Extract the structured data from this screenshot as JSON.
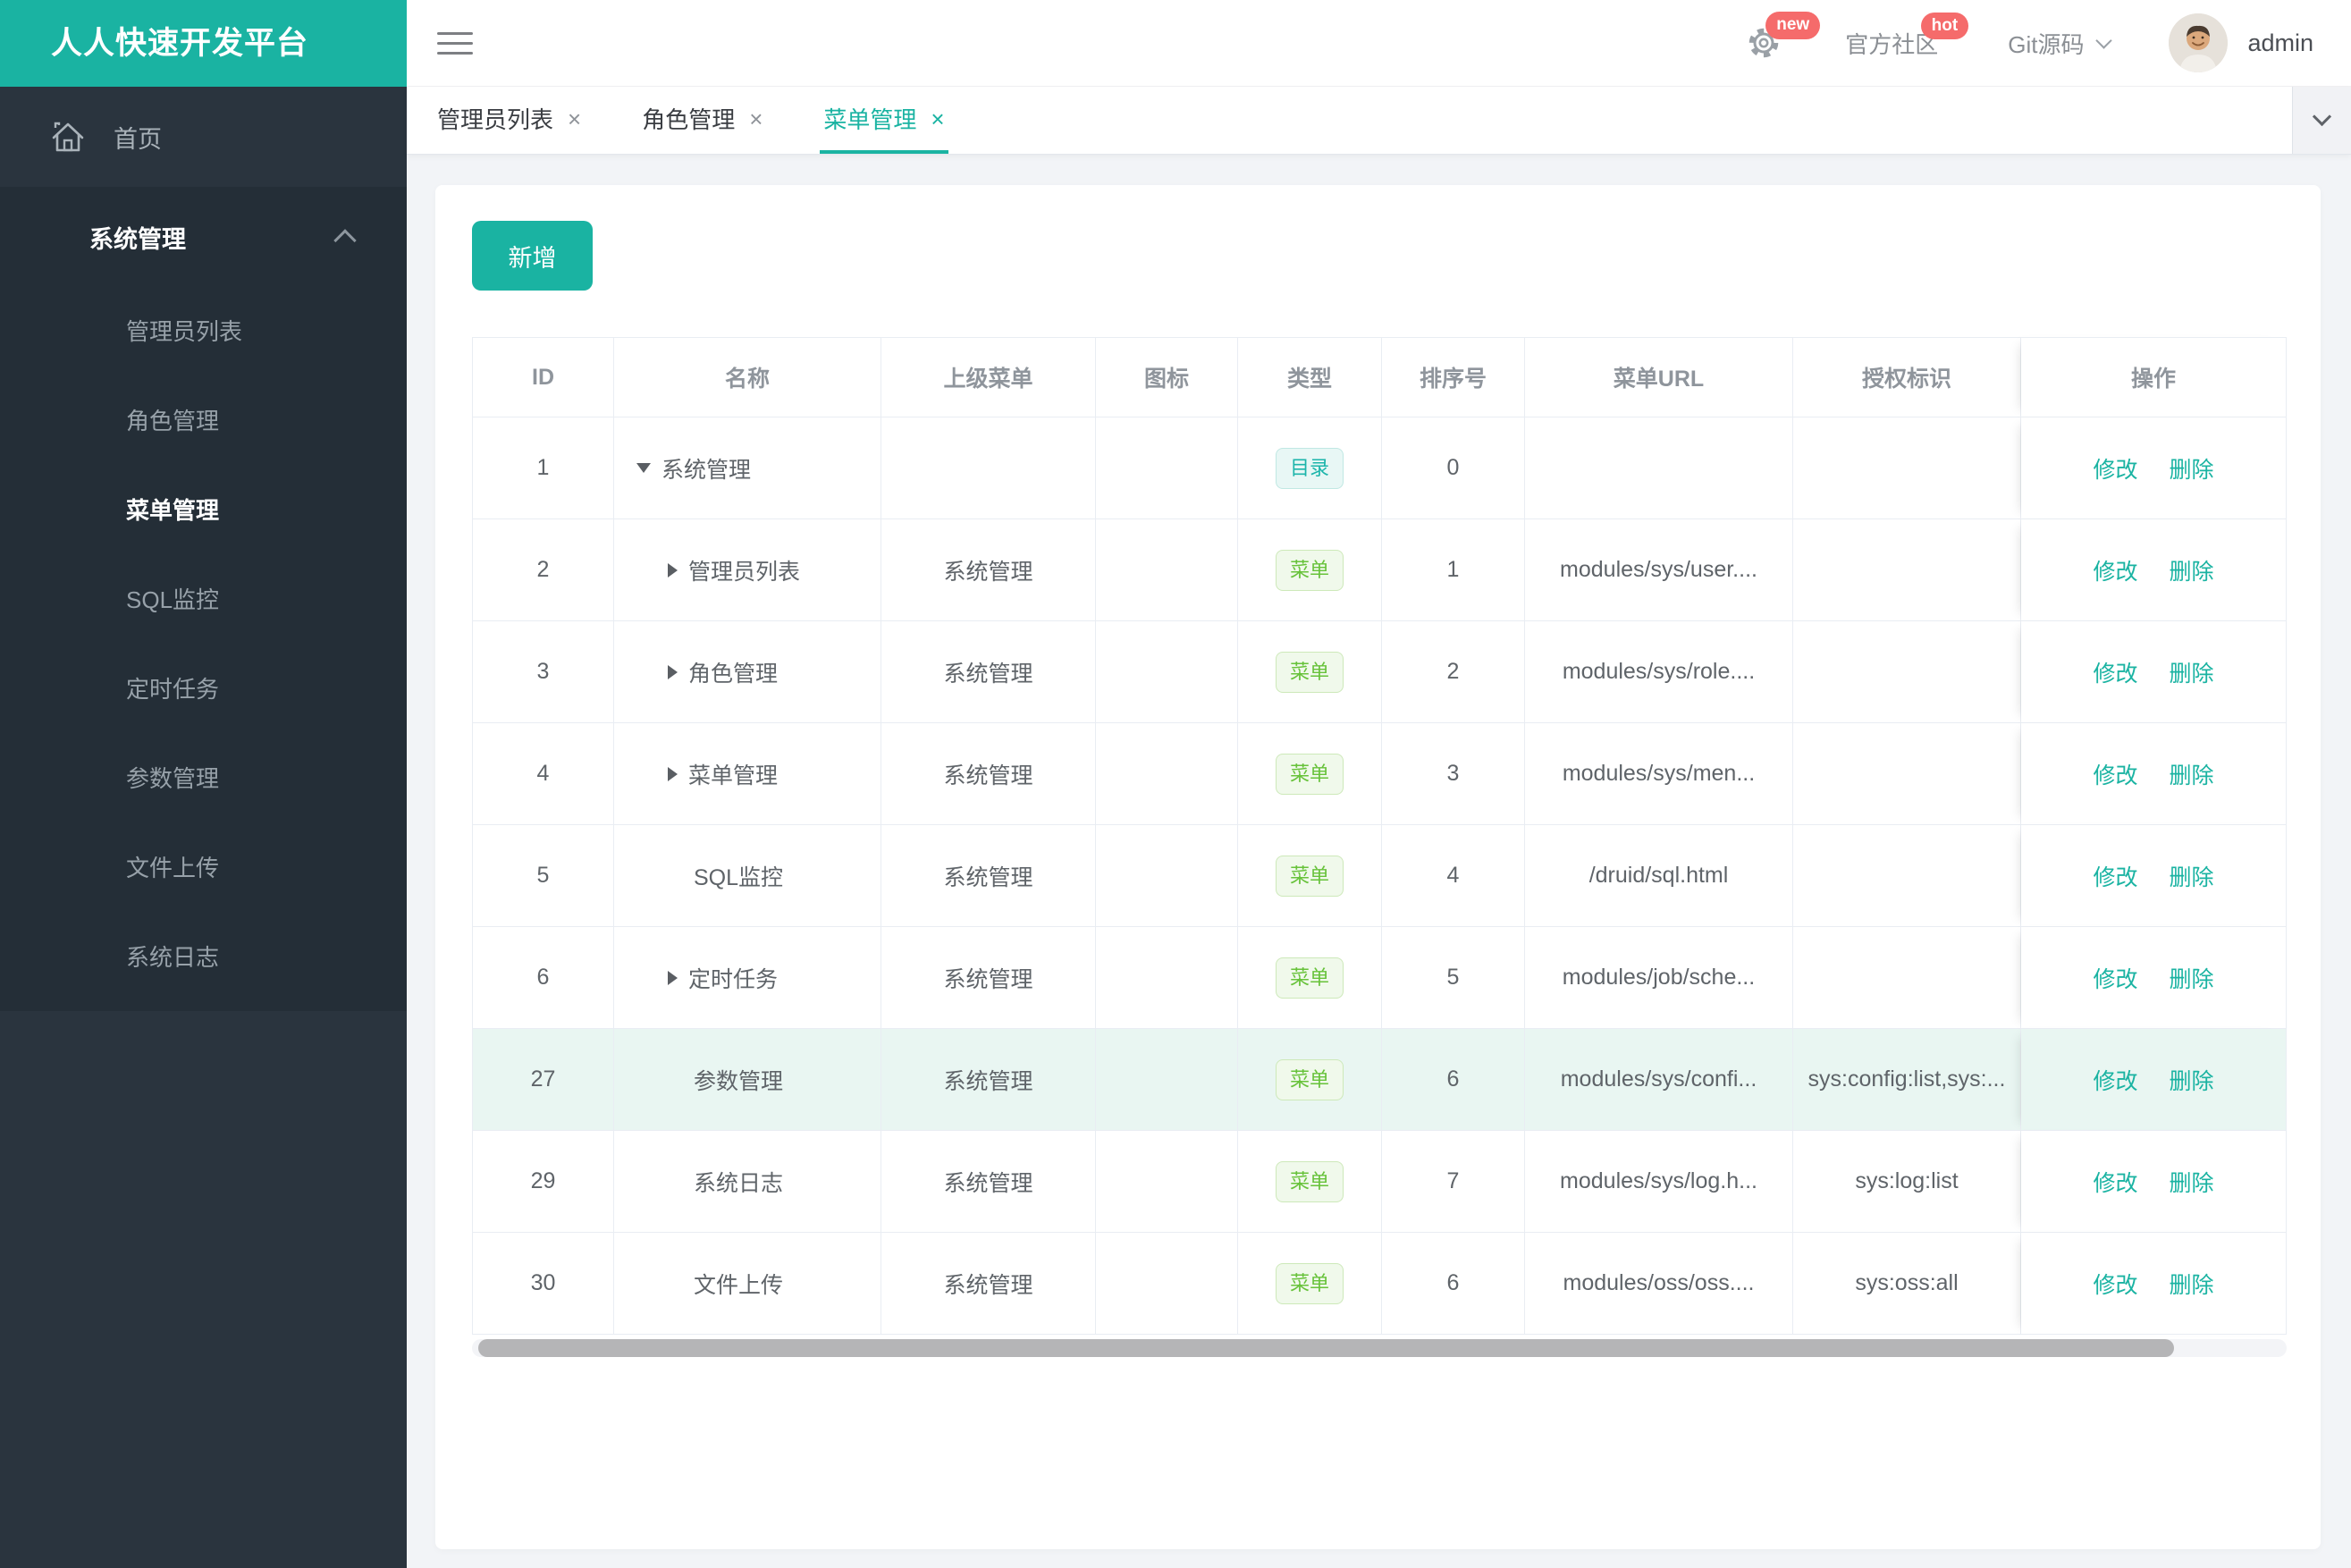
{
  "colors": {
    "primary_teal": "#1ab3a2",
    "badge_red": "#f56b6b",
    "tag_dir_text": "#1db5ab",
    "tag_menu_text": "#67c23a",
    "sidebar_bg": "#2a343e",
    "submenu_bg": "#242e37",
    "highlight_row_bg": "#e9f6f2"
  },
  "icons": {
    "close": "×"
  },
  "logo": {
    "title": "人人快速开发平台"
  },
  "topbar": {
    "new_badge": "new",
    "community": "官方社区",
    "hot_badge": "hot",
    "git": "Git源码",
    "username": "admin"
  },
  "sidebar": {
    "home": "首页",
    "group_title": "系统管理",
    "items": [
      {
        "label": "管理员列表",
        "active": false
      },
      {
        "label": "角色管理",
        "active": false
      },
      {
        "label": "菜单管理",
        "active": true
      },
      {
        "label": "SQL监控",
        "active": false
      },
      {
        "label": "定时任务",
        "active": false
      },
      {
        "label": "参数管理",
        "active": false
      },
      {
        "label": "文件上传",
        "active": false
      },
      {
        "label": "系统日志",
        "active": false
      }
    ]
  },
  "tabs": {
    "items": [
      {
        "label": "管理员列表",
        "active": false
      },
      {
        "label": "角色管理",
        "active": false
      },
      {
        "label": "菜单管理",
        "active": true
      }
    ]
  },
  "toolbar": {
    "add_label": "新增"
  },
  "table": {
    "columns": [
      "ID",
      "名称",
      "上级菜单",
      "图标",
      "类型",
      "排序号",
      "菜单URL",
      "授权标识",
      "操作"
    ],
    "actions": {
      "edit": "修改",
      "delete": "删除"
    },
    "rows": [
      {
        "id": "1",
        "caret": "down",
        "name": "系统管理",
        "parent": "",
        "icon": "",
        "type_label": "目录",
        "order": "0",
        "url": "",
        "perms": "",
        "highlighted": false
      },
      {
        "id": "2",
        "caret": "right",
        "name": "管理员列表",
        "parent": "系统管理",
        "icon": "",
        "type_label": "菜单",
        "order": "1",
        "url": "modules/sys/user....",
        "perms": "",
        "highlighted": false
      },
      {
        "id": "3",
        "caret": "right",
        "name": "角色管理",
        "parent": "系统管理",
        "icon": "",
        "type_label": "菜单",
        "order": "2",
        "url": "modules/sys/role....",
        "perms": "",
        "highlighted": false
      },
      {
        "id": "4",
        "caret": "right",
        "name": "菜单管理",
        "parent": "系统管理",
        "icon": "",
        "type_label": "菜单",
        "order": "3",
        "url": "modules/sys/men...",
        "perms": "",
        "highlighted": false
      },
      {
        "id": "5",
        "caret": "none",
        "name": "SQL监控",
        "parent": "系统管理",
        "icon": "",
        "type_label": "菜单",
        "order": "4",
        "url": "/druid/sql.html",
        "perms": "",
        "highlighted": false
      },
      {
        "id": "6",
        "caret": "right",
        "name": "定时任务",
        "parent": "系统管理",
        "icon": "",
        "type_label": "菜单",
        "order": "5",
        "url": "modules/job/sche...",
        "perms": "",
        "highlighted": false
      },
      {
        "id": "27",
        "caret": "none",
        "name": "参数管理",
        "parent": "系统管理",
        "icon": "",
        "type_label": "菜单",
        "order": "6",
        "url": "modules/sys/confi...",
        "perms": "sys:config:list,sys:...",
        "highlighted": true
      },
      {
        "id": "29",
        "caret": "none",
        "name": "系统日志",
        "parent": "系统管理",
        "icon": "",
        "type_label": "菜单",
        "order": "7",
        "url": "modules/sys/log.h...",
        "perms": "sys:log:list",
        "highlighted": false
      },
      {
        "id": "30",
        "caret": "none",
        "name": "文件上传",
        "parent": "系统管理",
        "icon": "",
        "type_label": "菜单",
        "order": "6",
        "url": "modules/oss/oss....",
        "perms": "sys:oss:all",
        "highlighted": false
      }
    ]
  }
}
